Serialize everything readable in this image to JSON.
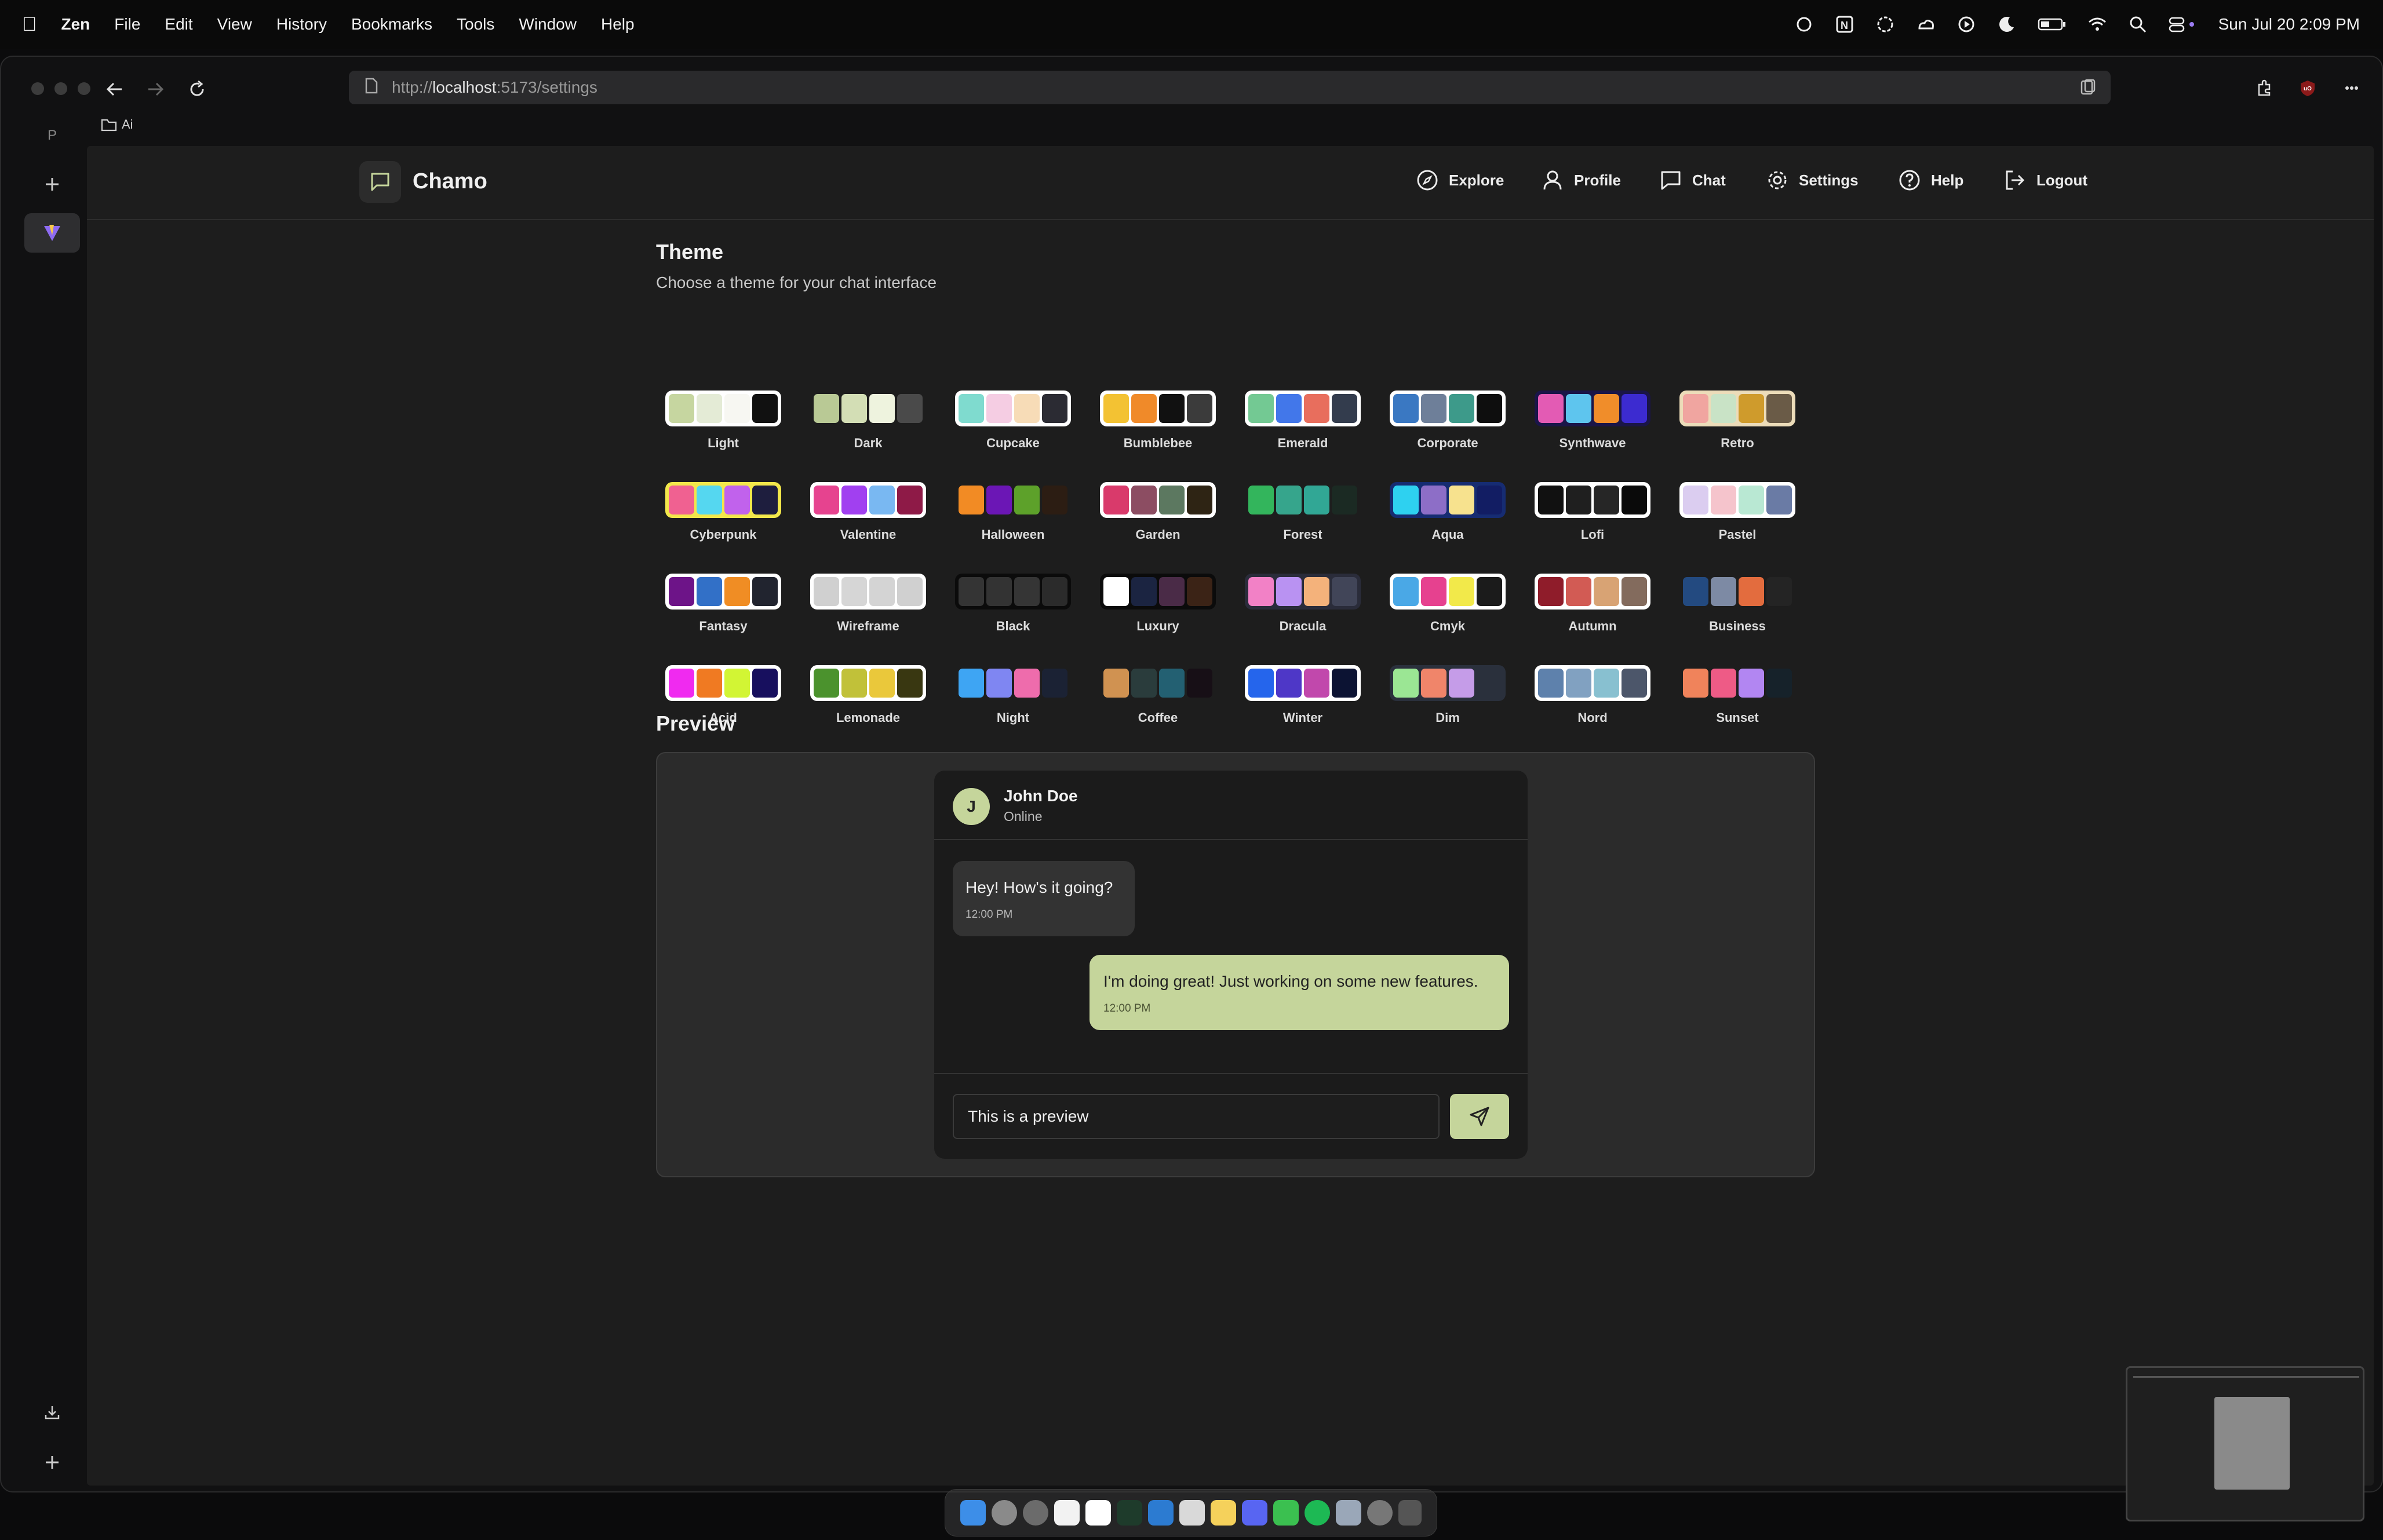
{
  "menubar": {
    "app": "Zen",
    "items": [
      "File",
      "Edit",
      "View",
      "History",
      "Bookmarks",
      "Tools",
      "Window",
      "Help"
    ],
    "datetime": "Sun Jul 20  2:09 PM"
  },
  "browser": {
    "url_prefix": "http://",
    "url_host": "localhost",
    "url_path": ":5173/settings",
    "folder": "Ai",
    "sidebar_letter": "P"
  },
  "app": {
    "brand": "Chamo",
    "nav": [
      {
        "label": "Explore",
        "icon": "compass-icon"
      },
      {
        "label": "Profile",
        "icon": "user-icon"
      },
      {
        "label": "Chat",
        "icon": "chat-bubble-icon"
      },
      {
        "label": "Settings",
        "icon": "gear-icon"
      },
      {
        "label": "Help",
        "icon": "help-circle-icon"
      },
      {
        "label": "Logout",
        "icon": "logout-icon"
      }
    ]
  },
  "theme": {
    "title": "Theme",
    "subtitle": "Choose a theme for your chat interface",
    "themes": [
      {
        "name": "Light",
        "bg": "#ffffff",
        "colors": [
          "#c6d6a0",
          "#e4ebd6",
          "#f7f7f2",
          "#111111"
        ]
      },
      {
        "name": "Dark",
        "bg": "none",
        "colors": [
          "#b9c995",
          "#d3deb5",
          "#eef3de",
          "#4a4a4a"
        ]
      },
      {
        "name": "Cupcake",
        "bg": "#ffffff",
        "colors": [
          "#7fdbcf",
          "#f5cde3",
          "#f7dcb7",
          "#2b2b33"
        ]
      },
      {
        "name": "Bumblebee",
        "bg": "#ffffff",
        "colors": [
          "#f3c233",
          "#f08a29",
          "#111111",
          "#3b3b3b"
        ]
      },
      {
        "name": "Emerald",
        "bg": "#ffffff",
        "colors": [
          "#73c993",
          "#4277ea",
          "#e86e5d",
          "#333c4d"
        ]
      },
      {
        "name": "Corporate",
        "bg": "#ffffff",
        "colors": [
          "#3a78c2",
          "#6e7f99",
          "#3d9a8a",
          "#0e0e0e"
        ]
      },
      {
        "name": "Synthwave",
        "bg": "#1a1548",
        "colors": [
          "#e35bb4",
          "#5ec5ee",
          "#f08d2a",
          "#3c2bd0"
        ]
      },
      {
        "name": "Retro",
        "bg": "#ecdcb9",
        "colors": [
          "#f0a5a0",
          "#c9e3c6",
          "#cf9b2c",
          "#6a5b47"
        ]
      },
      {
        "name": "Cyberpunk",
        "bg": "#f2e74b",
        "colors": [
          "#f06191",
          "#55d7f0",
          "#c162ec",
          "#1e1e3e"
        ]
      },
      {
        "name": "Valentine",
        "bg": "#ffffff",
        "colors": [
          "#e6438f",
          "#a140f0",
          "#79b8f2",
          "#8e1a47"
        ]
      },
      {
        "name": "Halloween",
        "bg": "none",
        "colors": [
          "#f28b24",
          "#6b16b5",
          "#5da12a",
          "#2c1d13"
        ]
      },
      {
        "name": "Garden",
        "bg": "#ffffff",
        "colors": [
          "#d93a6b",
          "#8c4d62",
          "#5c7860",
          "#2e2414"
        ]
      },
      {
        "name": "Forest",
        "bg": "none",
        "colors": [
          "#33b55c",
          "#36a58c",
          "#31a795",
          "#1b2a23"
        ]
      },
      {
        "name": "Aqua",
        "bg": "#162c72",
        "colors": [
          "#2ed1f0",
          "#8d6ec7",
          "#f7e28e",
          "#121d63"
        ]
      },
      {
        "name": "Lofi",
        "bg": "#ffffff",
        "colors": [
          "#111111",
          "#1f1f1f",
          "#262626",
          "#0a0a0a"
        ]
      },
      {
        "name": "Pastel",
        "bg": "#ffffff",
        "colors": [
          "#dbcdf0",
          "#f5c4cc",
          "#b9e8d3",
          "#6a7ba5"
        ]
      },
      {
        "name": "Fantasy",
        "bg": "#ffffff",
        "colors": [
          "#6d1488",
          "#3270c7",
          "#f08d24",
          "#21242f"
        ]
      },
      {
        "name": "Wireframe",
        "bg": "#ffffff",
        "colors": [
          "#d0d0d0",
          "#d6d6d6",
          "#d4d4d4",
          "#d0d0d0"
        ]
      },
      {
        "name": "Black",
        "bg": "#0b0b0b",
        "colors": [
          "#343434",
          "#333333",
          "#353535",
          "#2b2b2b"
        ]
      },
      {
        "name": "Luxury",
        "bg": "#0b0b0b",
        "colors": [
          "#ffffff",
          "#1b2441",
          "#4a2b47",
          "#3b2316"
        ]
      },
      {
        "name": "Dracula",
        "bg": "#2a2c3a",
        "colors": [
          "#f281c6",
          "#b992f2",
          "#f4b27b",
          "#414558"
        ]
      },
      {
        "name": "Cmyk",
        "bg": "#ffffff",
        "colors": [
          "#4aa8e6",
          "#e6418f",
          "#f2e94a",
          "#1b1b1b"
        ]
      },
      {
        "name": "Autumn",
        "bg": "#ffffff",
        "colors": [
          "#8f1c2a",
          "#d25b54",
          "#d8a374",
          "#836b5d"
        ]
      },
      {
        "name": "Business",
        "bg": "none",
        "colors": [
          "#234a80",
          "#7d8aa4",
          "#e36c3e",
          "#242424"
        ]
      },
      {
        "name": "Acid",
        "bg": "#ffffff",
        "colors": [
          "#f02af0",
          "#f07a22",
          "#d2f534",
          "#170f5e"
        ]
      },
      {
        "name": "Lemonade",
        "bg": "#ffffff",
        "colors": [
          "#4b922d",
          "#c1c139",
          "#eac83b",
          "#393711"
        ]
      },
      {
        "name": "Night",
        "bg": "none",
        "colors": [
          "#3ea5f3",
          "#7f86f2",
          "#ee6cac",
          "#1b2234"
        ]
      },
      {
        "name": "Coffee",
        "bg": "none",
        "colors": [
          "#d09251",
          "#2a3c3c",
          "#236072",
          "#170f16"
        ]
      },
      {
        "name": "Winter",
        "bg": "#ffffff",
        "colors": [
          "#2565ec",
          "#4e37c7",
          "#c148ac",
          "#0c1333"
        ]
      },
      {
        "name": "Dim",
        "bg": "#2a303c",
        "colors": [
          "#9be694",
          "#f0856a",
          "#c59ce8",
          "#2a303c"
        ]
      },
      {
        "name": "Nord",
        "bg": "#ffffff",
        "colors": [
          "#5e81ac",
          "#81a1c1",
          "#88c0d0",
          "#4c566a"
        ]
      },
      {
        "name": "Sunset",
        "bg": "none",
        "colors": [
          "#f0835b",
          "#ee5b86",
          "#b286f2",
          "#16222a"
        ]
      }
    ]
  },
  "preview": {
    "title": "Preview",
    "contact_initial": "J",
    "contact_name": "John Doe",
    "contact_status": "Online",
    "msg1_text": "Hey! How's it going?",
    "msg1_time": "12:00 PM",
    "msg2_text": "I'm doing great! Just working on some new features.",
    "msg2_time": "12:00 PM",
    "input_value": "This is a preview"
  },
  "colors": {
    "accent": "#c5d59b",
    "accent_dark": "#aebb85"
  }
}
